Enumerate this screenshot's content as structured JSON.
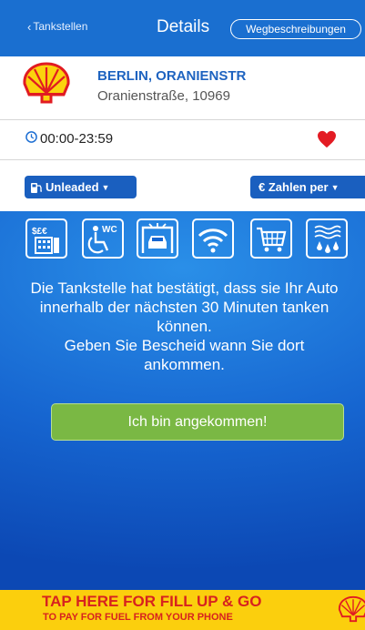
{
  "colors": {
    "nav": "#1a6fd0",
    "brand_blue": "#1a5fbf",
    "green": "#7ab844",
    "heart": "#e31b23",
    "banner": "#fbcf0d",
    "banner_text": "#d7221f"
  },
  "nav": {
    "back_label": "Tankstellen",
    "back_icon": "chevron-left-icon",
    "title": "Details",
    "directions_label": "Wegbeschreibungen"
  },
  "station": {
    "logo": "shell-logo",
    "name": "BERLIN, ORANIENSTR",
    "address": "Oranienstraße, 10969"
  },
  "hours": {
    "icon": "clock-icon",
    "text": "00:00-23:59",
    "favorite_icon": "heart-icon"
  },
  "filters": {
    "fuel_label": "Unleaded",
    "fuel_icon": "fuel-pump-icon",
    "pay_label": "€ Zahlen per"
  },
  "amenities": [
    {
      "icon": "atm-icon"
    },
    {
      "icon": "accessible-wc-icon"
    },
    {
      "icon": "car-wash-icon"
    },
    {
      "icon": "wifi-icon"
    },
    {
      "icon": "shop-cart-icon"
    },
    {
      "icon": "water-icon"
    }
  ],
  "message": {
    "line1": "Die Tankstelle hat bestätigt, dass sie Ihr Auto innerhalb der nächsten 30 Minuten tanken können.",
    "line2": "Geben Sie Bescheid wann Sie dort ankommen."
  },
  "arrived_button": "Ich bin angekommen!",
  "banner": {
    "title": "TAP HERE FOR FILL UP & GO",
    "subtitle": "TO PAY FOR FUEL FROM YOUR PHONE"
  }
}
